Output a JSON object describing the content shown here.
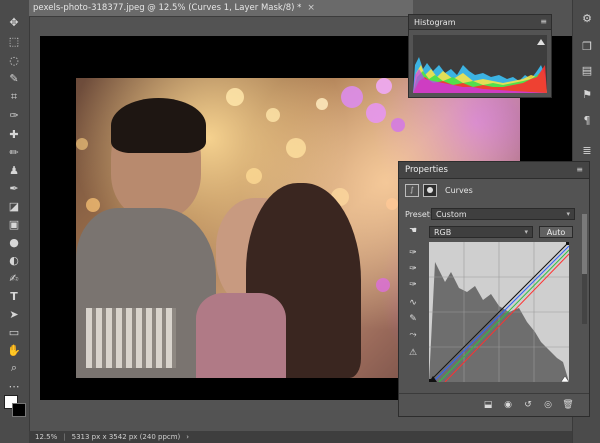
{
  "document": {
    "tab_title": "pexels-photo-318377.jpeg @ 12.5% (Curves 1, Layer Mask/8) *",
    "close_symbol": "×"
  },
  "histogram": {
    "title": "Histogram",
    "menu_symbol": "≡"
  },
  "properties": {
    "title": "Properties",
    "menu_symbol": "≡",
    "adjustment_name": "Curves",
    "preset_label": "Preset:",
    "preset_value": "Custom",
    "channel_value": "RGB",
    "auto_label": "Auto"
  },
  "status_bar": {
    "zoom": "12.5%",
    "doc_size": "5313 px x 3542 px (240 ppcm)",
    "arrow": "›"
  },
  "icons": {
    "toolbar": [
      "move-icon",
      "marquee-icon",
      "lasso-icon",
      "quick-select-icon",
      "crop-icon",
      "eyedropper-icon",
      "spot-heal-icon",
      "brush-icon",
      "clone-stamp-icon",
      "history-brush-icon",
      "eraser-icon",
      "gradient-icon",
      "blur-icon",
      "dodge-icon",
      "pen-icon",
      "type-icon",
      "path-select-icon",
      "rectangle-icon",
      "hand-icon",
      "zoom-icon",
      "more-tools-icon"
    ],
    "dock": [
      "history-panel-icon",
      "layers-panel-icon",
      "adjustments-icon",
      "libraries-icon",
      "paths-icon",
      "properties-icon"
    ]
  },
  "colors": {
    "ui_bg": "#535353",
    "panel_header": "#444444",
    "foreground_swatch": "#ffffff",
    "background_swatch": "#000000"
  }
}
